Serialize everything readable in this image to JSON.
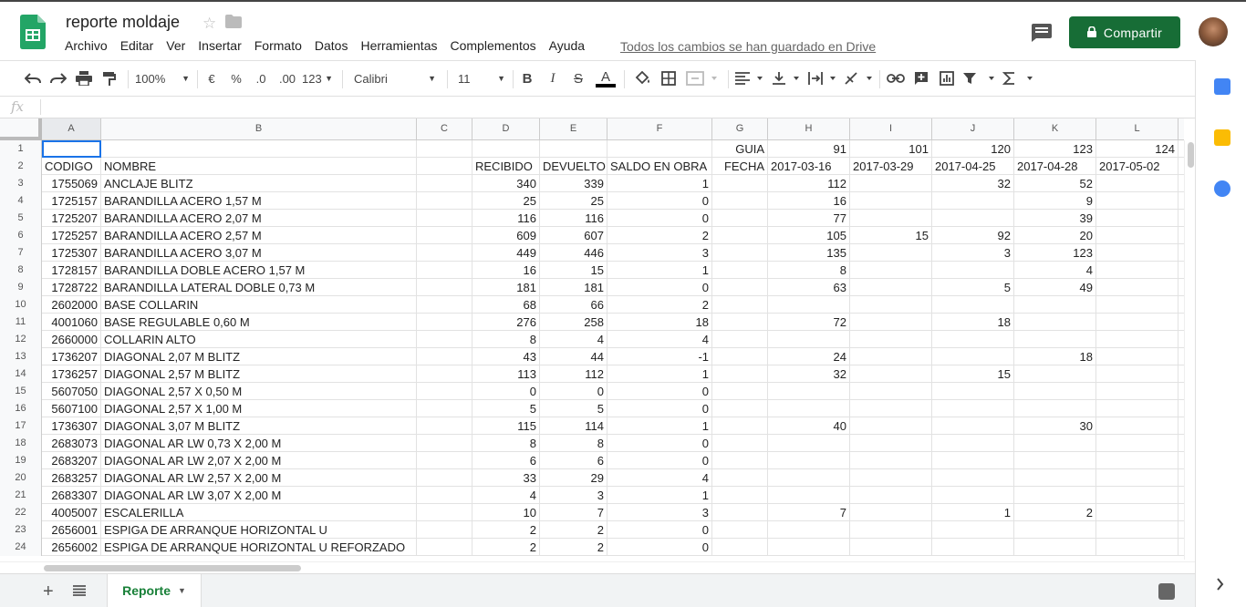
{
  "app": {
    "doc_title": "reporte moldaje",
    "save_status": "Todos los cambios se han guardado en Drive",
    "share_label": "Compartir",
    "brand_color": "#188038",
    "share_color": "#176d36"
  },
  "menu": [
    "Archivo",
    "Editar",
    "Ver",
    "Insertar",
    "Formato",
    "Datos",
    "Herramientas",
    "Complementos",
    "Ayuda"
  ],
  "toolbar": {
    "zoom": "100%",
    "currency": "€",
    "percent": "%",
    "dec_less": ".0",
    "dec_more": ".00",
    "format_more": "123",
    "font": "Calibri",
    "font_size": "11",
    "bold": "B",
    "italic": "I",
    "strike": "S",
    "text_color": "A"
  },
  "formula_bar": {
    "fx": "fx",
    "value": ""
  },
  "columns": [
    "A",
    "B",
    "C",
    "D",
    "E",
    "F",
    "G",
    "H",
    "I",
    "J",
    "K",
    "L"
  ],
  "rows": [
    {
      "n": "1",
      "A": "",
      "B": "",
      "C": "",
      "D": "",
      "E": "",
      "F": "",
      "G": "GUIA",
      "H": "91",
      "I": "101",
      "J": "120",
      "K": "123",
      "L": "124"
    },
    {
      "n": "2",
      "A": "CODIGO",
      "B": "NOMBRE",
      "C": "",
      "D": "RECIBIDO",
      "E": "DEVUELTO",
      "F": "SALDO EN OBRA",
      "G": "FECHA",
      "H": "2017-03-16",
      "I": "2017-03-29",
      "J": "2017-04-25",
      "K": "2017-04-28",
      "L": "2017-05-02"
    },
    {
      "n": "3",
      "A": "1755069",
      "B": "ANCLAJE BLITZ",
      "C": "",
      "D": "340",
      "E": "339",
      "F": "1",
      "G": "",
      "H": "112",
      "I": "",
      "J": "32",
      "K": "52",
      "L": ""
    },
    {
      "n": "4",
      "A": "1725157",
      "B": "BARANDILLA ACERO 1,57 M",
      "C": "",
      "D": "25",
      "E": "25",
      "F": "0",
      "G": "",
      "H": "16",
      "I": "",
      "J": "",
      "K": "9",
      "L": ""
    },
    {
      "n": "5",
      "A": "1725207",
      "B": "BARANDILLA ACERO 2,07 M",
      "C": "",
      "D": "116",
      "E": "116",
      "F": "0",
      "G": "",
      "H": "77",
      "I": "",
      "J": "",
      "K": "39",
      "L": ""
    },
    {
      "n": "6",
      "A": "1725257",
      "B": "BARANDILLA ACERO 2,57 M",
      "C": "",
      "D": "609",
      "E": "607",
      "F": "2",
      "G": "",
      "H": "105",
      "I": "15",
      "J": "92",
      "K": "20",
      "L": ""
    },
    {
      "n": "7",
      "A": "1725307",
      "B": "BARANDILLA ACERO 3,07 M",
      "C": "",
      "D": "449",
      "E": "446",
      "F": "3",
      "G": "",
      "H": "135",
      "I": "",
      "J": "3",
      "K": "123",
      "L": ""
    },
    {
      "n": "8",
      "A": "1728157",
      "B": "BARANDILLA DOBLE ACERO 1,57 M",
      "C": "",
      "D": "16",
      "E": "15",
      "F": "1",
      "G": "",
      "H": "8",
      "I": "",
      "J": "",
      "K": "4",
      "L": ""
    },
    {
      "n": "9",
      "A": "1728722",
      "B": "BARANDILLA LATERAL DOBLE 0,73 M",
      "C": "",
      "D": "181",
      "E": "181",
      "F": "0",
      "G": "",
      "H": "63",
      "I": "",
      "J": "5",
      "K": "49",
      "L": ""
    },
    {
      "n": "10",
      "A": "2602000",
      "B": "BASE COLLARIN",
      "C": "",
      "D": "68",
      "E": "66",
      "F": "2",
      "G": "",
      "H": "",
      "I": "",
      "J": "",
      "K": "",
      "L": ""
    },
    {
      "n": "11",
      "A": "4001060",
      "B": "BASE REGULABLE 0,60 M",
      "C": "",
      "D": "276",
      "E": "258",
      "F": "18",
      "G": "",
      "H": "72",
      "I": "",
      "J": "18",
      "K": "",
      "L": ""
    },
    {
      "n": "12",
      "A": "2660000",
      "B": "COLLARIN ALTO",
      "C": "",
      "D": "8",
      "E": "4",
      "F": "4",
      "G": "",
      "H": "",
      "I": "",
      "J": "",
      "K": "",
      "L": ""
    },
    {
      "n": "13",
      "A": "1736207",
      "B": "DIAGONAL 2,07 M BLITZ",
      "C": "",
      "D": "43",
      "E": "44",
      "F": "-1",
      "G": "",
      "H": "24",
      "I": "",
      "J": "",
      "K": "18",
      "L": ""
    },
    {
      "n": "14",
      "A": "1736257",
      "B": "DIAGONAL 2,57 M BLITZ",
      "C": "",
      "D": "113",
      "E": "112",
      "F": "1",
      "G": "",
      "H": "32",
      "I": "",
      "J": "15",
      "K": "",
      "L": ""
    },
    {
      "n": "15",
      "A": "5607050",
      "B": "DIAGONAL 2,57 X 0,50 M",
      "C": "",
      "D": "0",
      "E": "0",
      "F": "0",
      "G": "",
      "H": "",
      "I": "",
      "J": "",
      "K": "",
      "L": ""
    },
    {
      "n": "16",
      "A": "5607100",
      "B": "DIAGONAL 2,57 X 1,00 M",
      "C": "",
      "D": "5",
      "E": "5",
      "F": "0",
      "G": "",
      "H": "",
      "I": "",
      "J": "",
      "K": "",
      "L": ""
    },
    {
      "n": "17",
      "A": "1736307",
      "B": "DIAGONAL 3,07 M BLITZ",
      "C": "",
      "D": "115",
      "E": "114",
      "F": "1",
      "G": "",
      "H": "40",
      "I": "",
      "J": "",
      "K": "30",
      "L": ""
    },
    {
      "n": "18",
      "A": "2683073",
      "B": "DIAGONAL AR LW 0,73 X 2,00 M",
      "C": "",
      "D": "8",
      "E": "8",
      "F": "0",
      "G": "",
      "H": "",
      "I": "",
      "J": "",
      "K": "",
      "L": ""
    },
    {
      "n": "19",
      "A": "2683207",
      "B": "DIAGONAL AR LW 2,07 X 2,00 M",
      "C": "",
      "D": "6",
      "E": "6",
      "F": "0",
      "G": "",
      "H": "",
      "I": "",
      "J": "",
      "K": "",
      "L": ""
    },
    {
      "n": "20",
      "A": "2683257",
      "B": "DIAGONAL AR LW 2,57 X 2,00 M",
      "C": "",
      "D": "33",
      "E": "29",
      "F": "4",
      "G": "",
      "H": "",
      "I": "",
      "J": "",
      "K": "",
      "L": ""
    },
    {
      "n": "21",
      "A": "2683307",
      "B": "DIAGONAL AR LW 3,07 X 2,00 M",
      "C": "",
      "D": "4",
      "E": "3",
      "F": "1",
      "G": "",
      "H": "",
      "I": "",
      "J": "",
      "K": "",
      "L": ""
    },
    {
      "n": "22",
      "A": "4005007",
      "B": "ESCALERILLA",
      "C": "",
      "D": "10",
      "E": "7",
      "F": "3",
      "G": "",
      "H": "7",
      "I": "",
      "J": "1",
      "K": "2",
      "L": ""
    },
    {
      "n": "23",
      "A": "2656001",
      "B": "ESPIGA DE ARRANQUE HORIZONTAL U",
      "C": "",
      "D": "2",
      "E": "2",
      "F": "0",
      "G": "",
      "H": "",
      "I": "",
      "J": "",
      "K": "",
      "L": ""
    },
    {
      "n": "24",
      "A": "2656002",
      "B": "ESPIGA DE ARRANQUE HORIZONTAL U REFORZADO",
      "C": "",
      "D": "2",
      "E": "2",
      "F": "0",
      "G": "",
      "H": "",
      "I": "",
      "J": "",
      "K": "",
      "L": ""
    }
  ],
  "sheet_tab": "Reporte"
}
